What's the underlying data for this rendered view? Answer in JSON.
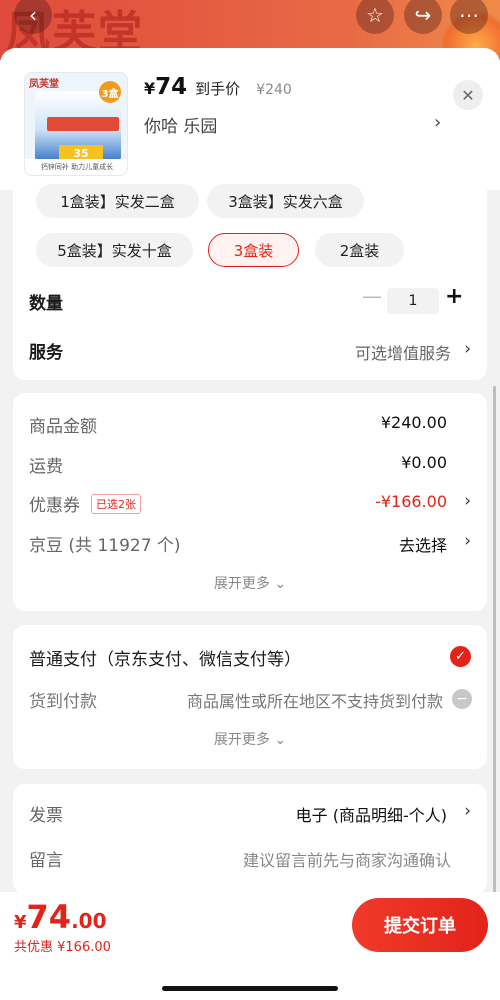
{
  "background": {
    "brand": "凤芙堂"
  },
  "product": {
    "currency": "¥",
    "price": "74",
    "price_tag": "到手价",
    "original_price": "¥240",
    "spec_line": "你哈  乐园",
    "image": {
      "badge": "3盒",
      "yellow": "35",
      "strip": "钙锌同补 助力儿童成长",
      "logo": "凤芙堂"
    }
  },
  "spec_options": [
    "1盒装】实发二盒",
    "3盒装】实发六盒",
    "5盒装】实发十盒",
    "3盒装",
    "2盒装"
  ],
  "selected_option": "3盒装",
  "quantity": {
    "label": "数量",
    "value": "1"
  },
  "service": {
    "label": "服务",
    "value": "可选增值服务"
  },
  "fees": {
    "goods_label": "商品金额",
    "goods_value": "¥240.00",
    "shipping_label": "运费",
    "shipping_value": "¥0.00",
    "coupon_label": "优惠券",
    "coupon_tag": "已选2张",
    "coupon_value": "-¥166.00",
    "jingdou_label": "京豆 (共 11927 个)",
    "jingdou_value": "去选择",
    "more": "展开更多"
  },
  "payment": {
    "normal_label": "普通支付（京东支付、微信支付等）",
    "cod_label": "货到付款",
    "cod_note": "商品属性或所在地区不支持货到付款",
    "more": "展开更多"
  },
  "invoice": {
    "label": "发票",
    "value": "电子 (商品明细-个人)",
    "note_label": "留言",
    "note_placeholder": "建议留言前先与商家沟通确认"
  },
  "bottom": {
    "currency": "¥",
    "total_int": "74",
    "total_dec": ".00",
    "saved": "共优惠 ¥166.00",
    "submit": "提交订单"
  },
  "colors": {
    "accent": "#e2231a",
    "chip_bg": "#f2f2f2"
  }
}
